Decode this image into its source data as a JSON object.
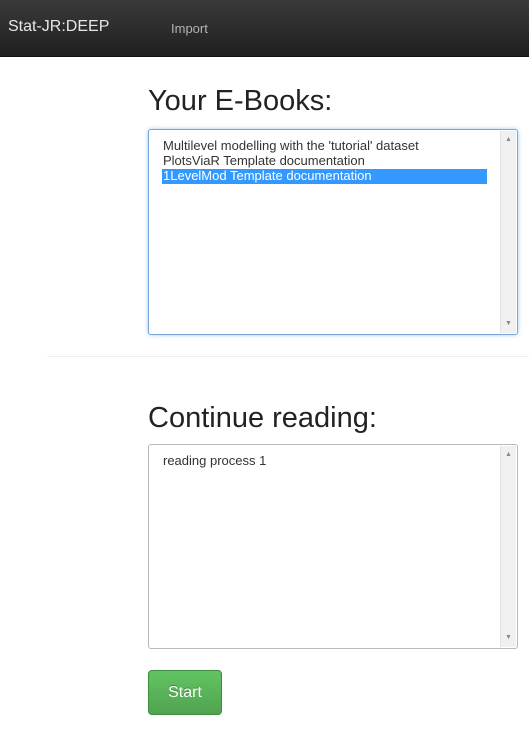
{
  "navbar": {
    "brand": "Stat-JR:DEEP",
    "links": [
      "Import"
    ]
  },
  "ebooks": {
    "title": "Your E-Books:",
    "items": [
      "Multilevel modelling with the 'tutorial' dataset",
      "PlotsViaR Template documentation",
      "1LevelMod Template documentation"
    ],
    "selected_index": 2
  },
  "continue_reading": {
    "title": "Continue reading:",
    "items": [
      "reading process 1"
    ]
  },
  "actions": {
    "start_label": "Start"
  },
  "colors": {
    "navbar_bg": "#2b2b2b",
    "selection": "#3399ff",
    "start_button": "#51a351",
    "focus_border": "#7ba7d8"
  },
  "icons": {
    "scroll_up": "triangle-up-icon",
    "scroll_down": "triangle-down-icon"
  }
}
